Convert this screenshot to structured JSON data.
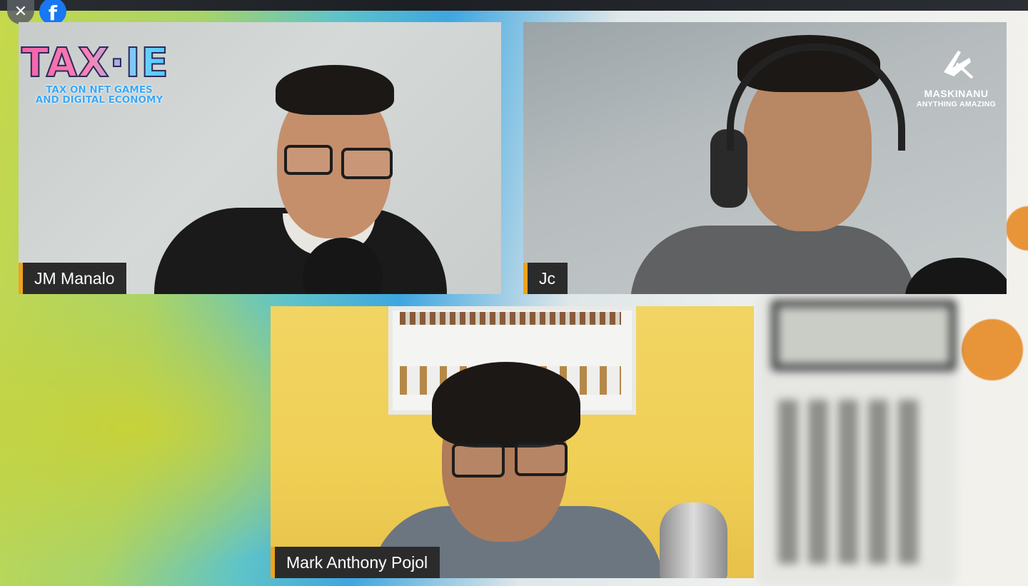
{
  "controls": {
    "close_icon": "close-icon",
    "close_glyph": "✕",
    "facebook_icon": "facebook-icon",
    "facebook_glyph": "f"
  },
  "participants": [
    {
      "name": "JM Manalo",
      "name_color": "#ffffff",
      "accent": "#f0a21b"
    },
    {
      "name": "Jc",
      "name_color": "#ffffff",
      "accent": "#f0a21b"
    },
    {
      "name": "Mark Anthony Pojol",
      "name_color": "#ffffff",
      "accent": "#f0a21b"
    }
  ],
  "overlays": {
    "taxie": {
      "wordmark": "TAX·IE",
      "subtitle_line1": "TAX ON NFT GAMES",
      "subtitle_line2": "AND DIGITAL ECONOMY"
    },
    "maskinanu": {
      "name": "MASKINANU",
      "tagline": "ANYTHING AMAZING"
    }
  }
}
